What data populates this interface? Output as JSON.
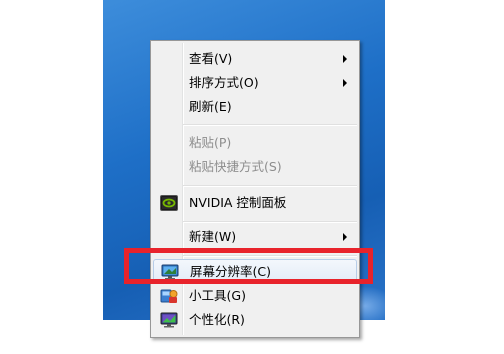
{
  "menu": {
    "items": [
      {
        "label": "查看(V)",
        "submenu": true,
        "enabled": true
      },
      {
        "label": "排序方式(O)",
        "submenu": true,
        "enabled": true
      },
      {
        "label": "刷新(E)",
        "submenu": false,
        "enabled": true
      },
      {
        "label": "粘贴(P)",
        "submenu": false,
        "enabled": false
      },
      {
        "label": "粘贴快捷方式(S)",
        "submenu": false,
        "enabled": false
      },
      {
        "label": "NVIDIA 控制面板",
        "submenu": false,
        "enabled": true,
        "icon": "nvidia-icon"
      },
      {
        "label": "新建(W)",
        "submenu": true,
        "enabled": true
      },
      {
        "label": "屏幕分辨率(C)",
        "submenu": false,
        "enabled": true,
        "icon": "monitor-icon",
        "highlighted": true
      },
      {
        "label": "小工具(G)",
        "submenu": false,
        "enabled": true,
        "icon": "gadgets-icon"
      },
      {
        "label": "个性化(R)",
        "submenu": false,
        "enabled": true,
        "icon": "personalize-icon"
      }
    ]
  },
  "colors": {
    "desktop": "#1e6fc7",
    "menu_bg": "#f0f0f0",
    "highlight_box": "#e8232b",
    "disabled_text": "#8d8d8d"
  }
}
